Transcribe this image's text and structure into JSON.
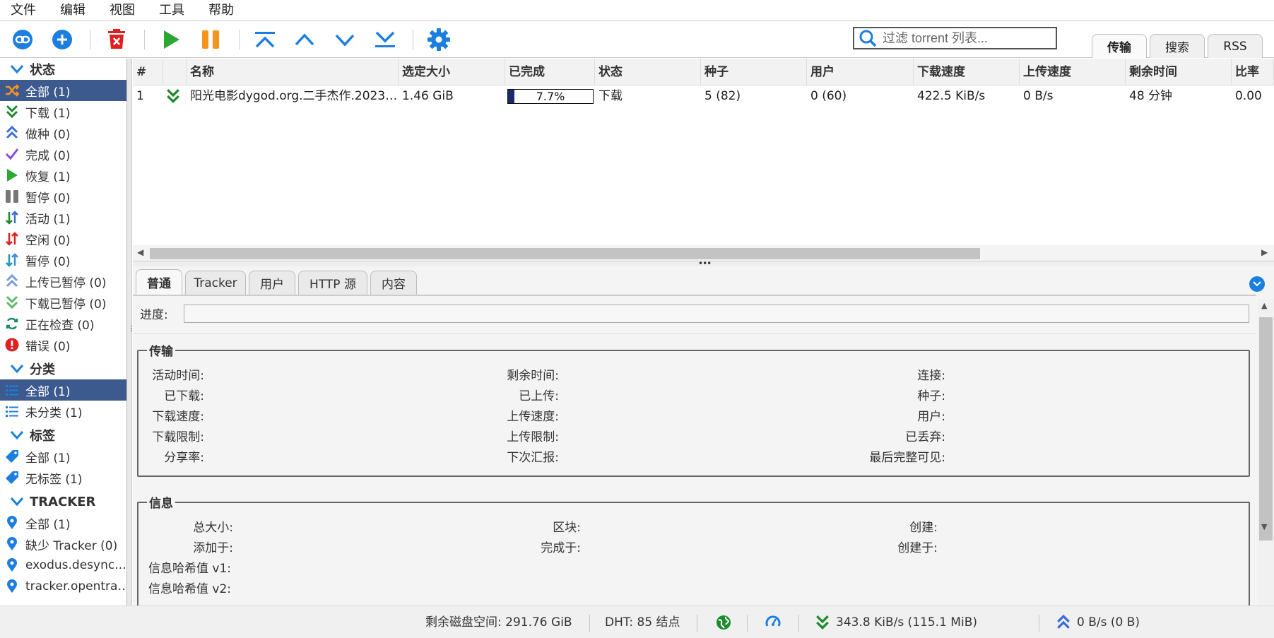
{
  "menu": [
    "文件",
    "编辑",
    "视图",
    "工具",
    "帮助"
  ],
  "toolbar": {
    "icons": [
      "add-link-icon",
      "add-torrent-icon",
      "delete-icon",
      "resume-icon",
      "pause-icon",
      "move-top-icon",
      "move-up-icon",
      "move-down-icon",
      "move-bottom-icon",
      "settings-icon"
    ],
    "search_placeholder": "过滤 torrent 列表...",
    "tabs": [
      "传输",
      "搜索",
      "RSS"
    ]
  },
  "sidebar": {
    "status_header": "状态",
    "status_items": [
      {
        "label": "全部 (1)",
        "icon": "shuffle-icon"
      },
      {
        "label": "下载 (1)",
        "icon": "download-icon"
      },
      {
        "label": "做种 (0)",
        "icon": "seeding-icon"
      },
      {
        "label": "完成 (0)",
        "icon": "checkmark-icon"
      },
      {
        "label": "恢复 (1)",
        "icon": "resume-icon"
      },
      {
        "label": "暂停 (0)",
        "icon": "pause-icon"
      },
      {
        "label": "活动 (1)",
        "icon": "active-arrows-icon"
      },
      {
        "label": "空闲 (0)",
        "icon": "idle-arrows-icon"
      },
      {
        "label": "暂停 (0)",
        "icon": "stalled-arrows-icon"
      },
      {
        "label": "上传已暂停 (0)",
        "icon": "upload-stalled-icon"
      },
      {
        "label": "下载已暂停 (0)",
        "icon": "download-stalled-icon"
      },
      {
        "label": "正在检查 (0)",
        "icon": "checking-icon"
      },
      {
        "label": "错误 (0)",
        "icon": "error-icon"
      }
    ],
    "category_header": "分类",
    "category_items": [
      {
        "label": "全部 (1)",
        "icon": "list-icon"
      },
      {
        "label": "未分类 (1)",
        "icon": "list-icon"
      }
    ],
    "tag_header": "标签",
    "tag_items": [
      {
        "label": "全部 (1)",
        "icon": "tag-icon"
      },
      {
        "label": "无标签 (1)",
        "icon": "tag-icon"
      }
    ],
    "tracker_header": "TRACKER",
    "tracker_items": [
      {
        "label": "全部 (1)",
        "icon": "location-pin-icon"
      },
      {
        "label": "缺少 Tracker (0)",
        "icon": "location-pin-icon"
      },
      {
        "label": "exodus.desync.…",
        "icon": "location-pin-icon"
      },
      {
        "label": "tracker.opentra…",
        "icon": "location-pin-icon"
      }
    ]
  },
  "torrent_list": {
    "columns": [
      "#",
      "",
      "名称",
      "选定大小",
      "已完成",
      "状态",
      "种子",
      "用户",
      "下载速度",
      "上传速度",
      "剩余时间",
      "比率"
    ],
    "rows": [
      {
        "num": "1",
        "name": "阳光电影dygod.org.二手杰作.2023…",
        "size": "1.46 GiB",
        "progress_text": "7.7%",
        "progress": 0.077,
        "status": "下载",
        "seeds": "5 (82)",
        "peers": "0 (60)",
        "down_speed": "422.5 KiB/s",
        "up_speed": "0 B/s",
        "eta": "48 分钟",
        "ratio": "0.00"
      }
    ]
  },
  "detail": {
    "tabs": [
      "普通",
      "Tracker",
      "用户",
      "HTTP 源",
      "内容"
    ],
    "progress_label": "进度:",
    "transfer_title": "传输",
    "transfer_fields": {
      "col1": [
        "活动时间:",
        "已下载:",
        "下载速度:",
        "下载限制:",
        "分享率:"
      ],
      "col2": [
        "剩余时间:",
        "已上传:",
        "上传速度:",
        "上传限制:",
        "下次汇报:"
      ],
      "col3": [
        "连接:",
        "种子:",
        "用户:",
        "已丢弃:",
        "最后完整可见:"
      ]
    },
    "info_title": "信息",
    "info_fields": {
      "col1": [
        "总大小:",
        "添加于:",
        "信息哈希值 v1:",
        "信息哈希值 v2:"
      ],
      "col2": [
        "区块:",
        "完成于:"
      ],
      "col3": [
        "创建:",
        "创建于:"
      ]
    }
  },
  "statusbar": {
    "free_space": "剩余磁盘空间: 291.76 GiB",
    "dht": "DHT: 85 结点",
    "download": "343.8 KiB/s (115.1 MiB)",
    "upload": "0 B/s (0 B)"
  },
  "colors": {
    "accent_blue": "#1c7fe0",
    "selection": "#3c5a8e",
    "green": "#2aa833",
    "orange": "#f7941d",
    "red": "#e02020",
    "progress_fill": "#1b2a6b"
  }
}
